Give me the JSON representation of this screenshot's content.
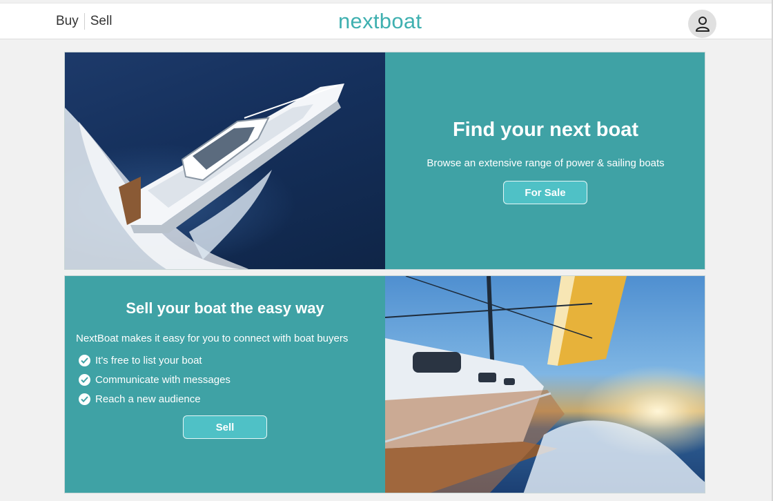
{
  "header": {
    "nav": [
      {
        "label": "Buy"
      },
      {
        "label": "Sell"
      }
    ],
    "logo": "nextboat",
    "account_icon": "user-icon"
  },
  "hero_buy": {
    "title": "Find your next boat",
    "subtitle": "Browse an extensive range of power & sailing boats",
    "button_label": "For Sale"
  },
  "hero_sell": {
    "title": "Sell your boat the easy way",
    "intro": "NextBoat makes it easy for you to connect with boat buyers",
    "benefits": [
      "It's free to list your boat",
      "Communicate with messages",
      "Reach a new audience"
    ],
    "button_label": "Sell"
  },
  "colors": {
    "brand": "#3fb0b0",
    "panel_teal": "#3fa2a5",
    "button": "#4fc1c6"
  }
}
